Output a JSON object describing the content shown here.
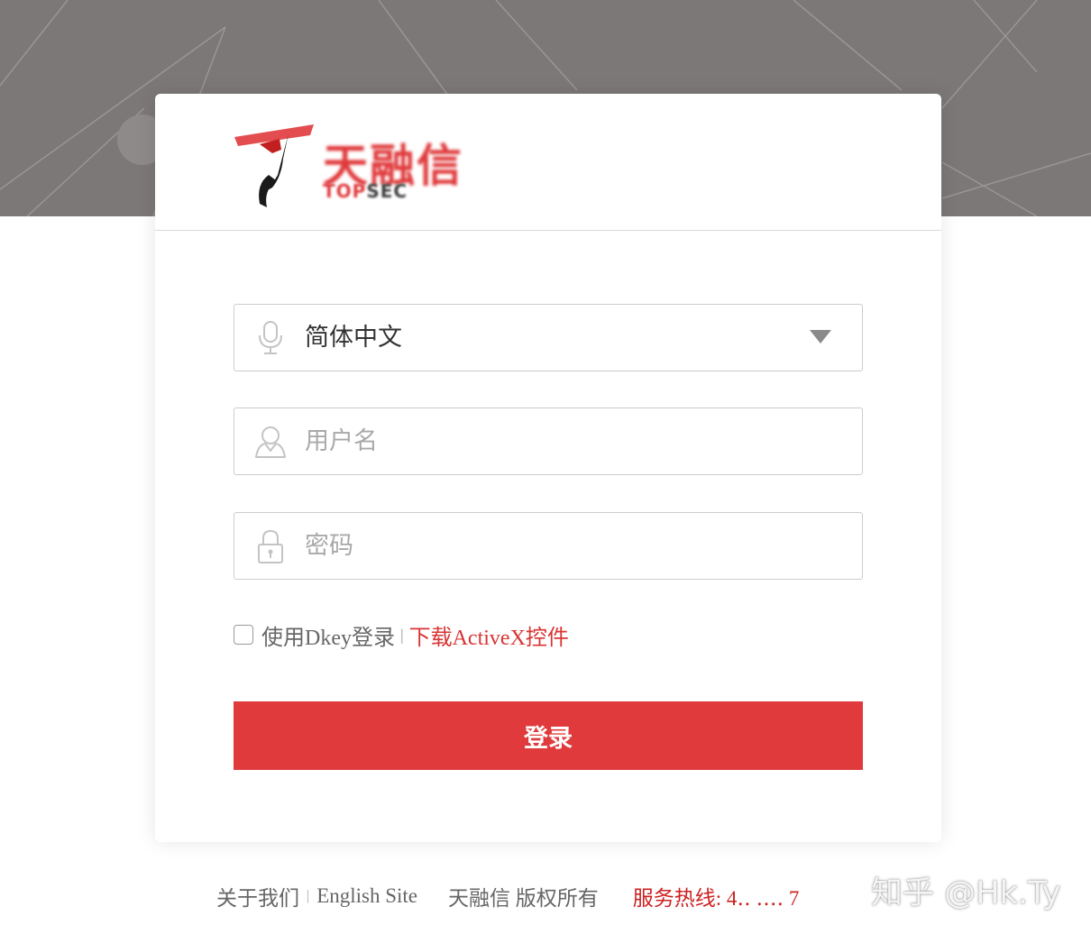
{
  "brand": {
    "logo_text": "天融信",
    "logo_sub_red": "TOP",
    "logo_sub_dark": "SEC"
  },
  "form": {
    "language_value": "简体中文",
    "username_placeholder": "用户名",
    "password_placeholder": "密码",
    "dkey_label": "使用Dkey登录",
    "dkey_separator": "|",
    "download_link": "下载ActiveX控件",
    "login_button": "登录"
  },
  "footer": {
    "about": "关于我们",
    "separator": "|",
    "english_site": "English Site",
    "copyright": "天融信 版权所有",
    "hotline": "服务热线: 4‥ ‥‥ 7"
  },
  "watermark": "知乎 @Hk.Ty",
  "colors": {
    "accent": "#e03a3c",
    "link": "#d93434",
    "hotline": "#cc2222",
    "background_band": "#7c7878"
  },
  "icons": {
    "language": "microphone-icon",
    "username": "user-icon",
    "password": "lock-icon",
    "dropdown": "caret-down-icon"
  }
}
